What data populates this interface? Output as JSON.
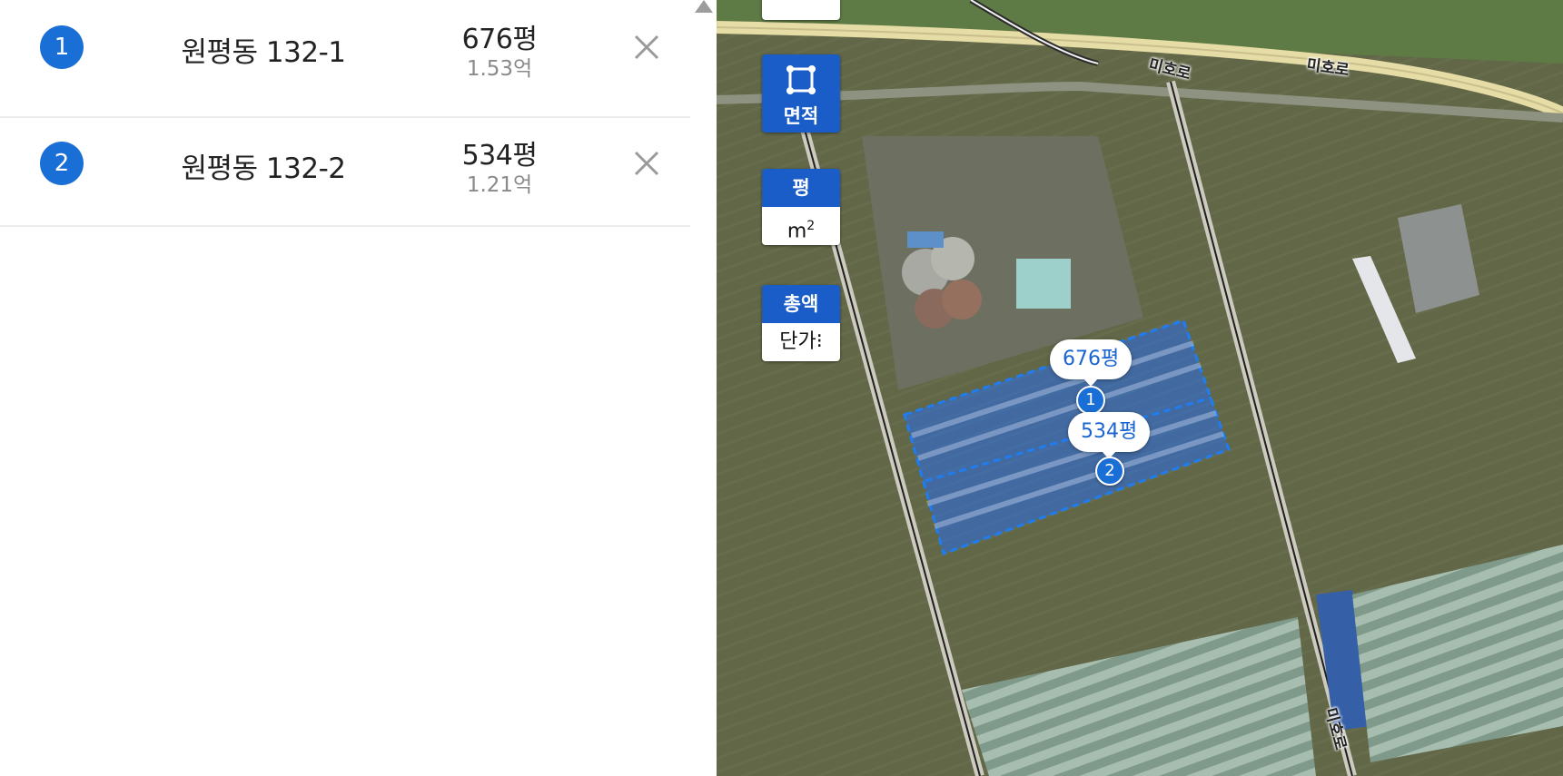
{
  "parcels": [
    {
      "num": "1",
      "name": "원평동 132-1",
      "area": "676평",
      "price": "1.53억"
    },
    {
      "num": "2",
      "name": "원평동 132-2",
      "area": "534평",
      "price": "1.21억"
    }
  ],
  "remove_icon": "×",
  "icons": {
    "remove": "close-icon",
    "area_tool": "square-select-icon",
    "scroll_up": "triangle-up-icon"
  },
  "map": {
    "area_tool_label": "면적",
    "unit_toggle": {
      "active": "평",
      "inactive_base": "m",
      "inactive_sup": "2"
    },
    "price_toggle": {
      "active": "총액",
      "inactive": "단가⁝"
    },
    "area_labels": [
      {
        "num": "1",
        "area": "676평"
      },
      {
        "num": "2",
        "area": "534평"
      }
    ],
    "road_labels": [
      "미호로",
      "미호로",
      "미호로"
    ]
  },
  "colors": {
    "accent": "#1a6fd6",
    "control_blue": "#1a5dc8",
    "selection_fill": "rgba(40,110,235,0.55)"
  }
}
